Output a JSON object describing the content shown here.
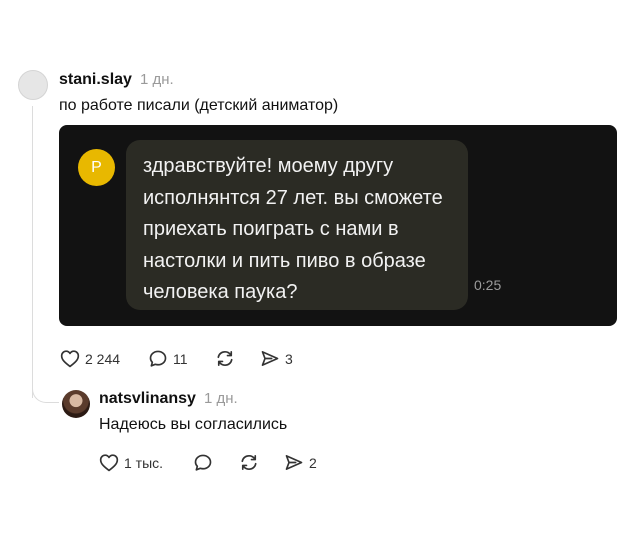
{
  "post": {
    "username": "stani.slay",
    "time": "1 дн.",
    "text": "по работе писали (детский аниматор)",
    "media": {
      "sender_initial": "P",
      "sender_color": "#e8b800",
      "message_lines": [
        "здравствуйте! моему другу",
        "исполнянтся 27 лет. вы сможете",
        "приехать поиграть с нами в",
        "настолки и пить пиво в образе",
        "человека паука?"
      ],
      "message_time": "0:25"
    },
    "actions": {
      "likes": "2 244",
      "comments": "11",
      "reposts": "",
      "shares": "3"
    }
  },
  "reply": {
    "username": "natsvlinansy",
    "time": "1 дн.",
    "text": "Надеюсь вы согласились",
    "actions": {
      "likes": "1 тыс.",
      "comments": "",
      "reposts": "",
      "shares": "2"
    }
  },
  "icons": {
    "like": "heart-icon",
    "comment": "comment-bubble-icon",
    "repost": "repost-arrows-icon",
    "share": "send-icon"
  }
}
